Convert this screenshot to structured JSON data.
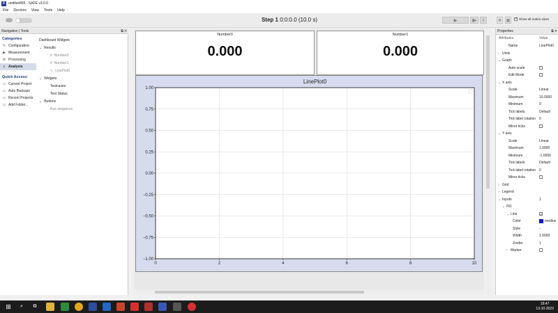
{
  "window": {
    "title": "untitled455 - SAFE v3.0.0"
  },
  "menu": [
    "File",
    "Devices",
    "View",
    "Tools",
    "Help"
  ],
  "toolbar": {
    "step_bold": "Step 1",
    "step_rest": " 0:0:0.0 (10.0 s)",
    "show_all_matrix_sizes": "Show all matrix sizes"
  },
  "nav": {
    "title": "Navigation | Tools",
    "categories_title": "Categories",
    "categories": [
      {
        "label": "Configuration",
        "icon": "wrench-icon",
        "glyph": "✎"
      },
      {
        "label": "Measurement",
        "icon": "play-icon",
        "glyph": "▶"
      },
      {
        "label": "Processing",
        "icon": "process-icon",
        "glyph": "⚙"
      },
      {
        "label": "Analysis",
        "icon": "analysis-icon",
        "glyph": "🔍"
      }
    ],
    "quick_access_title": "Quick Access",
    "quick_access": [
      {
        "label": "Current Project",
        "icon": "folder-icon"
      },
      {
        "label": "Auto Backups",
        "icon": "folder-icon"
      },
      {
        "label": "Recent Projects",
        "icon": "folder-icon"
      },
      {
        "label": "Add Folder...",
        "icon": "folder-add-icon"
      }
    ],
    "tree": {
      "title": "Dashboard Widgets",
      "results": "Results",
      "number0": "Number0",
      "number1": "Number1",
      "lineplot0": "LinePlot0",
      "widgets": "Widgets",
      "testcases": "Testcases",
      "test_status": "Test Status",
      "buttons": "Buttons",
      "run_sequence": "Run sequence"
    }
  },
  "dashboard": {
    "number0": {
      "label": "Number0",
      "value": "0.000"
    },
    "number1": {
      "label": "Number1",
      "value": "0.000"
    }
  },
  "chart_data": {
    "type": "line",
    "title": "LinePlot0",
    "xlabel": "",
    "ylabel": "",
    "xlim": [
      0,
      10
    ],
    "ylim": [
      -1.0,
      1.0
    ],
    "xticks": [
      "0",
      "2",
      "4",
      "6",
      "8",
      "10"
    ],
    "yticks": [
      "1.00",
      "0.75",
      "0.50",
      "0.25",
      "0.00",
      "−0.25",
      "−0.50",
      "−0.75",
      "−1.00"
    ],
    "grid": true,
    "series": []
  },
  "properties": {
    "title": "Properties",
    "col_attr": "Attributes",
    "col_val": "Value",
    "rows": [
      {
        "k": "Name",
        "v": "LinePlot0",
        "depth": 2
      },
      {
        "k": "Units",
        "v": "",
        "depth": 0,
        "arrow": "›"
      },
      {
        "k": "Graph",
        "v": "",
        "depth": 0,
        "arrow": "⌄"
      },
      {
        "k": "Auto scale",
        "v": "",
        "depth": 2,
        "check": "off"
      },
      {
        "k": "Edit Mode",
        "v": "",
        "depth": 2,
        "check": "off"
      },
      {
        "k": "X axis",
        "v": "",
        "depth": 0,
        "arrow": "⌄"
      },
      {
        "k": "Scale",
        "v": "Linear",
        "depth": 2
      },
      {
        "k": "Maximum",
        "v": "10.0000",
        "depth": 2
      },
      {
        "k": "Minimum",
        "v": "0",
        "depth": 2
      },
      {
        "k": "Tick labels",
        "v": "Default",
        "depth": 2
      },
      {
        "k": "Tick label rotation",
        "v": "0",
        "depth": 2
      },
      {
        "k": "Minor ticks",
        "v": "",
        "depth": 2,
        "check": "off"
      },
      {
        "k": "Y axis",
        "v": "",
        "depth": 0,
        "arrow": "⌄"
      },
      {
        "k": "Scale",
        "v": "Linear",
        "depth": 2
      },
      {
        "k": "Maximum",
        "v": "1.0000",
        "depth": 2
      },
      {
        "k": "Minimum",
        "v": "-1.0000",
        "depth": 2
      },
      {
        "k": "Tick labels",
        "v": "Default",
        "depth": 2
      },
      {
        "k": "Tick label rotation",
        "v": "0",
        "depth": 2
      },
      {
        "k": "Minor ticks",
        "v": "",
        "depth": 2,
        "check": "off"
      },
      {
        "k": "Grid",
        "v": "",
        "depth": 0,
        "arrow": "›"
      },
      {
        "k": "Legend",
        "v": "",
        "depth": 0,
        "arrow": "›"
      },
      {
        "k": "Inputs",
        "v": "1",
        "depth": 0,
        "arrow": "⌄"
      },
      {
        "k": "IN1",
        "v": "",
        "depth": 1,
        "arrow": "⌄"
      },
      {
        "k": "Line",
        "v": "",
        "depth": 2,
        "arrow": "⌄",
        "check": "on"
      },
      {
        "k": "Color",
        "v": "mediun",
        "depth": 3,
        "swatch": "#0a14c8"
      },
      {
        "k": "Style",
        "v": "-",
        "depth": 3
      },
      {
        "k": "Width",
        "v": "1.0000",
        "depth": 3
      },
      {
        "k": "Zorder",
        "v": "1",
        "depth": 3
      },
      {
        "k": "Marker",
        "v": "",
        "depth": 2,
        "arrow": "›",
        "check": "off"
      }
    ]
  },
  "taskbar": {
    "time": "18:47",
    "date": "13-10-2022"
  },
  "colors": {
    "plot_bg": "#d6dcee",
    "accent": "#1e3b7a"
  }
}
